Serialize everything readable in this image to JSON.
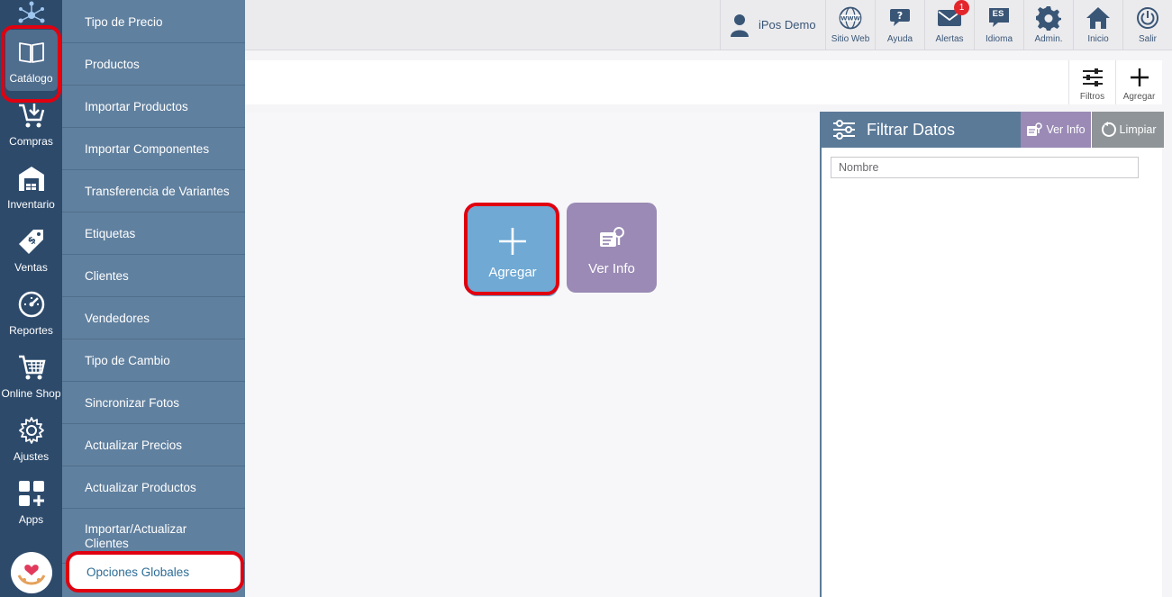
{
  "rail": {
    "items": [
      {
        "label": "Catálogo",
        "icon": "book-icon"
      },
      {
        "label": "Compras",
        "icon": "cart-plus-icon"
      },
      {
        "label": "Inventario",
        "icon": "warehouse-icon"
      },
      {
        "label": "Ventas",
        "icon": "price-tag-icon"
      },
      {
        "label": "Reportes",
        "icon": "gauge-icon"
      },
      {
        "label": "Online Shop",
        "icon": "shopping-cart-icon"
      },
      {
        "label": "Ajustes",
        "icon": "gear-icon"
      },
      {
        "label": "Apps",
        "icon": "apps-grid-icon"
      }
    ]
  },
  "submenu": {
    "items": [
      {
        "label": "Tipo de Precio"
      },
      {
        "label": "Productos"
      },
      {
        "label": "Importar Productos"
      },
      {
        "label": "Importar Componentes"
      },
      {
        "label": "Transferencia de Variantes"
      },
      {
        "label": "Etiquetas"
      },
      {
        "label": "Clientes"
      },
      {
        "label": "Vendedores"
      },
      {
        "label": "Tipo de Cambio"
      },
      {
        "label": "Sincronizar Fotos"
      },
      {
        "label": "Actualizar Precios"
      },
      {
        "label": "Actualizar Productos"
      },
      {
        "label": "Importar/Actualizar Clientes"
      },
      {
        "label": "Opciones Globales"
      }
    ]
  },
  "header": {
    "user": "iPos Demo",
    "buttons": [
      {
        "label": "Sitio Web",
        "icon": "globe-www-icon"
      },
      {
        "label": "Ayuda",
        "icon": "help-bubble-icon"
      },
      {
        "label": "Alertas",
        "icon": "mail-icon",
        "badge": "1"
      },
      {
        "label": "Idioma",
        "icon": "language-icon",
        "code": "ES"
      },
      {
        "label": "Admin.",
        "icon": "gear-icon"
      },
      {
        "label": "Inicio",
        "icon": "home-icon"
      },
      {
        "label": "Salir",
        "icon": "power-icon"
      }
    ]
  },
  "toolbar": {
    "filtros": "Filtros",
    "agregar": "Agregar"
  },
  "main": {
    "agregar": "Agregar",
    "ver_info": "Ver Info"
  },
  "filter": {
    "title": "Filtrar Datos",
    "ver_info": "Ver Info",
    "limpiar": "Limpiar",
    "placeholder": "Nombre"
  },
  "colors": {
    "rail": "#2d4a6b",
    "submenu": "#60809f",
    "agregar_btn": "#6fa9d4",
    "ver_info_btn": "#9a8ab5",
    "highlight": "#e00010"
  }
}
